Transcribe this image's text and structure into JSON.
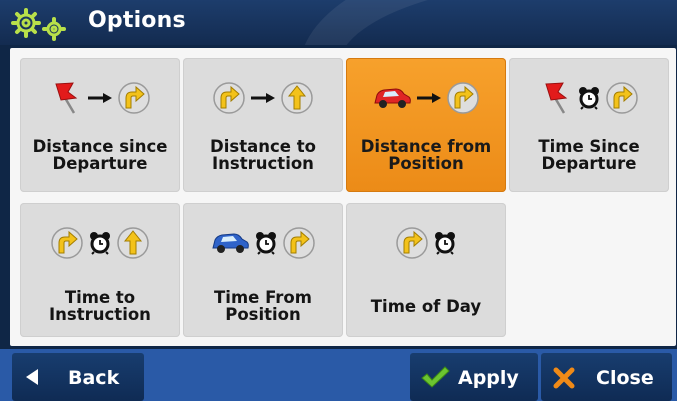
{
  "header": {
    "title": "Options",
    "icon": "gear-icon"
  },
  "tiles": [
    {
      "label": "Distance since Departure",
      "icons": [
        "flag-icon",
        "arrow-right-icon",
        "turn-arrow-icon"
      ],
      "selected": false
    },
    {
      "label": "Distance to Instruction",
      "icons": [
        "turn-arrow-icon",
        "arrow-right-icon",
        "straight-arrow-icon"
      ],
      "selected": false
    },
    {
      "label": "Distance from Position",
      "icons": [
        "car-icon",
        "arrow-right-icon",
        "turn-arrow-icon"
      ],
      "selected": true
    },
    {
      "label": "Time Since Departure",
      "icons": [
        "flag-icon",
        "alarm-clock-icon",
        "turn-arrow-icon"
      ],
      "selected": false
    },
    {
      "label": "Time to Instruction",
      "icons": [
        "turn-arrow-icon",
        "alarm-clock-icon",
        "straight-arrow-icon"
      ],
      "selected": false
    },
    {
      "label": "Time From Position",
      "icons": [
        "car-icon",
        "alarm-clock-icon",
        "turn-arrow-icon"
      ],
      "selected": false
    },
    {
      "label": "Time of Day",
      "icons": [
        "turn-arrow-icon",
        "alarm-clock-icon"
      ],
      "selected": false
    }
  ],
  "footer": {
    "back_label": "Back",
    "apply_label": "Apply",
    "close_label": "Close"
  },
  "colors": {
    "selected": "#f39a22",
    "tile": "#dcdcdc",
    "header": "#16325c",
    "footer": "#2a5aa7"
  }
}
